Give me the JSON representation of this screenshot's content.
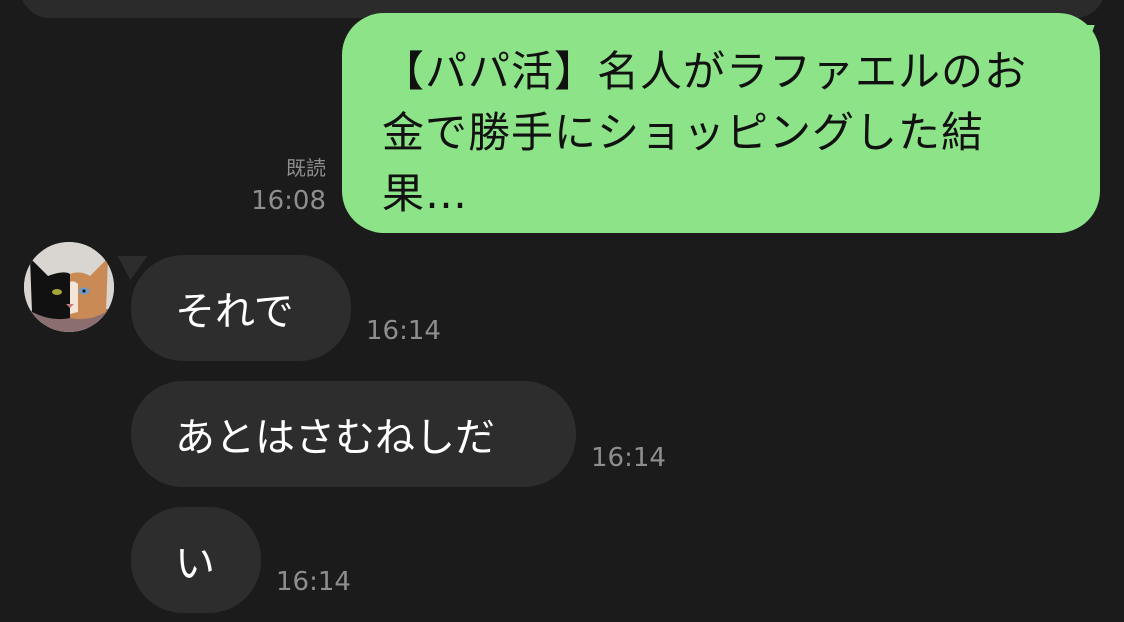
{
  "outgoing": {
    "text": "【パパ活】名人がラファエルのお金で勝手にショッピングした結果…",
    "read_label": "既読",
    "time": "16:08",
    "bubble_color": "#8de388"
  },
  "incoming": [
    {
      "text": "それで",
      "time": "16:14"
    },
    {
      "text": "あとはさむねしだ",
      "time": "16:14"
    },
    {
      "text": "い",
      "time": "16:14"
    }
  ],
  "avatar": {
    "icon": "cat-avatar-icon"
  },
  "colors": {
    "background": "#1b1b1b",
    "incoming_bubble": "#2d2d2d",
    "meta_text": "#8e8e8e"
  }
}
